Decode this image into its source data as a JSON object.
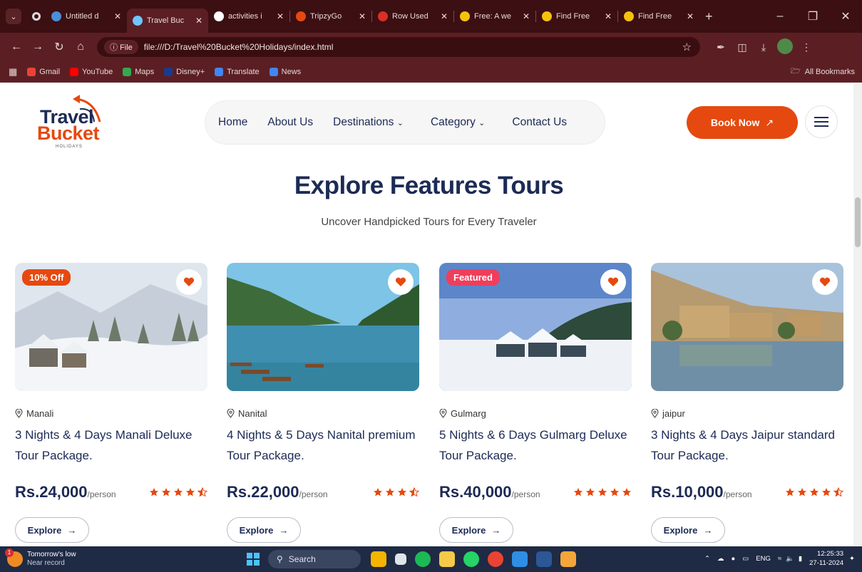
{
  "browser": {
    "tabs": [
      {
        "label": "Untitled d",
        "color": "#4a90d9",
        "active": false
      },
      {
        "label": "Travel Buc",
        "color": "#6ec6ff",
        "active": true
      },
      {
        "label": "activities i",
        "color": "#ffffff",
        "active": false
      },
      {
        "label": "TripzyGo",
        "color": "#e5490f",
        "active": false
      },
      {
        "label": "Row Used",
        "color": "#d93025",
        "active": false
      },
      {
        "label": "Free: A we",
        "color": "#f4c20d",
        "active": false
      },
      {
        "label": "Find Free",
        "color": "#f4c20d",
        "active": false
      },
      {
        "label": "Find Free",
        "color": "#f4c20d",
        "active": false
      }
    ],
    "file_chip": "File",
    "url": "file:///D:/Travel%20Bucket%20Holidays/index.html",
    "bookmarks": [
      {
        "label": "Gmail",
        "color": "#ea4335"
      },
      {
        "label": "YouTube",
        "color": "#ff0000"
      },
      {
        "label": "Maps",
        "color": "#34a853"
      },
      {
        "label": "Disney+",
        "color": "#1a3a8f"
      },
      {
        "label": "Translate",
        "color": "#4285f4"
      },
      {
        "label": "News",
        "color": "#4285f4"
      }
    ],
    "all_bookmarks": "All Bookmarks"
  },
  "site": {
    "logo": {
      "line1": "Travel",
      "line2": "Bucket",
      "line3": "HOLIDAYS"
    },
    "nav": [
      {
        "label": "Home",
        "dropdown": false
      },
      {
        "label": "About Us",
        "dropdown": false
      },
      {
        "label": "Destinations",
        "dropdown": true
      },
      {
        "label": "Category",
        "dropdown": true
      },
      {
        "label": "Contact Us",
        "dropdown": false
      }
    ],
    "book_now": "Book Now",
    "accent": "#e5490f",
    "navy": "#1c2a55"
  },
  "section": {
    "title": "Explore Features Tours",
    "subtitle": "Uncover Handpicked Tours for Every Traveler"
  },
  "cards": [
    {
      "badge": "10% Off",
      "badge_type": "offer",
      "location": "Manali",
      "title": "3 Nights & 4 Days Manali Deluxe Tour Package.",
      "price": "Rs.24,000",
      "per": "/person",
      "rating": 4.5,
      "explore": "Explore",
      "scene": "snow-village"
    },
    {
      "badge": "",
      "badge_type": "",
      "location": "Nanital",
      "title": "4 Nights & 5 Days Nanital premium Tour Package.",
      "price": "Rs.22,000",
      "per": "/person",
      "rating": 3.5,
      "explore": "Explore",
      "scene": "lake"
    },
    {
      "badge": "Featured",
      "badge_type": "featured",
      "location": "Gulmarg",
      "title": "5 Nights & 6 Days Gulmarg Deluxe Tour Package.",
      "price": "Rs.40,000",
      "per": "/person",
      "rating": 5,
      "explore": "Explore",
      "scene": "snow-chalet"
    },
    {
      "badge": "",
      "badge_type": "",
      "location": "jaipur",
      "title": "3 Nights & 4 Days Jaipur standard Tour Package.",
      "price": "Rs.10,000",
      "per": "/person",
      "rating": 4.5,
      "explore": "Explore",
      "scene": "fort"
    }
  ],
  "taskbar": {
    "weather_line1": "Tomorrow's low",
    "weather_line2": "Near record",
    "weather_badge": "1",
    "search": "Search",
    "lang": "ENG",
    "time": "12:25:33",
    "date": "27-11-2024"
  }
}
